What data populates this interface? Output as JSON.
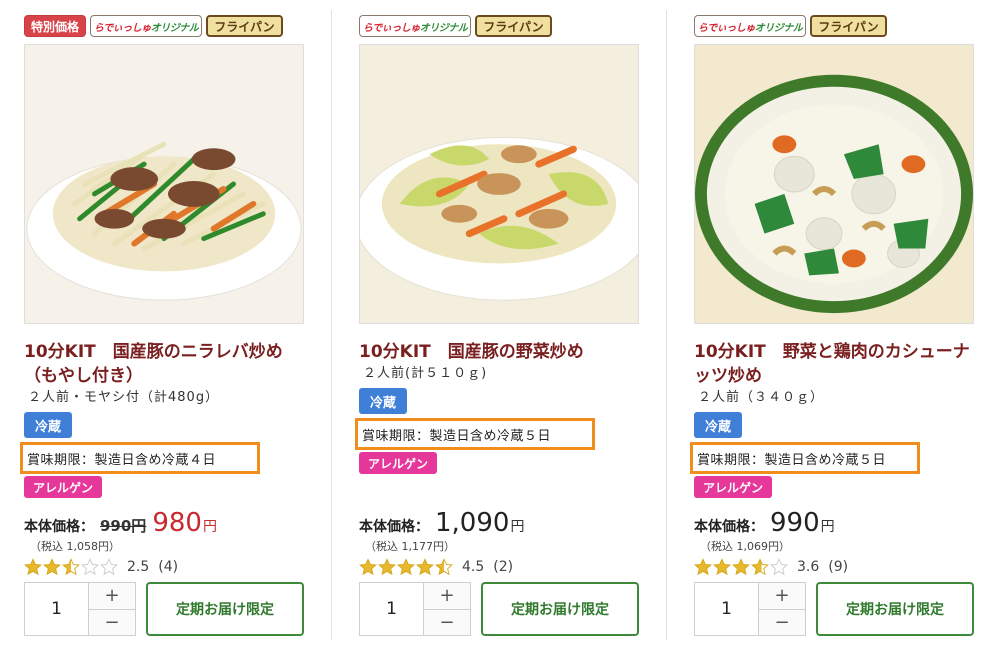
{
  "products": [
    {
      "tags": {
        "sale": "特別価格",
        "original_a": "らでぃっしゅ",
        "original_b": "オリジナル",
        "pan": "フライパン"
      },
      "title": "10分KIT　国産豚のニラレバ炒め（もやし付き）",
      "subtitle": "２人前・モヤシ付（計480g）",
      "storage": "冷蔵",
      "expiry": "賞味期限：製造日含め冷蔵４日",
      "allergy": "アレルゲン",
      "price_label": "本体価格：",
      "price_old": "990円",
      "price_value": "980",
      "price_unit": "円",
      "tax": "（税込 1,058円）",
      "rating": 2.5,
      "rating_text": "2.5",
      "review_count": "(4)",
      "quantity": "1",
      "plus": "+",
      "minus": "−",
      "order_label": "定期お届け限定"
    },
    {
      "tags": {
        "original_a": "らでぃっしゅ",
        "original_b": "オリジナル",
        "pan": "フライパン"
      },
      "title": "10分KIT　国産豚の野菜炒め",
      "subtitle": "２人前(計５１０ｇ)",
      "storage": "冷蔵",
      "expiry": "賞味期限：製造日含め冷蔵５日",
      "allergy": "アレルゲン",
      "price_label": "本体価格：",
      "price_value": "1,090",
      "price_unit": "円",
      "tax": "（税込 1,177円）",
      "rating": 4.5,
      "rating_text": "4.5",
      "review_count": "(2)",
      "quantity": "1",
      "plus": "+",
      "minus": "−",
      "order_label": "定期お届け限定"
    },
    {
      "tags": {
        "original_a": "らでぃっしゅ",
        "original_b": "オリジナル",
        "pan": "フライパン"
      },
      "title": "10分KIT　野菜と鶏肉のカシューナッツ炒め",
      "subtitle": "２人前（３４０ｇ）",
      "storage": "冷蔵",
      "expiry": "賞味期限：製造日含め冷蔵５日",
      "allergy": "アレルゲン",
      "price_label": "本体価格：",
      "price_value": "990",
      "price_unit": "円",
      "tax": "（税込 1,069円）",
      "rating": 3.6,
      "rating_text": "3.6",
      "review_count": "(9)",
      "quantity": "1",
      "plus": "+",
      "minus": "−",
      "order_label": "定期お届け限定"
    }
  ],
  "colors": {
    "title": "#7a1f1f",
    "sale_price": "#c9282d",
    "expiry_highlight": "#f08d1c",
    "star_filled": "#e6b82a",
    "star_empty": "#c9c9c9",
    "order_button": "#3d8a3a"
  }
}
